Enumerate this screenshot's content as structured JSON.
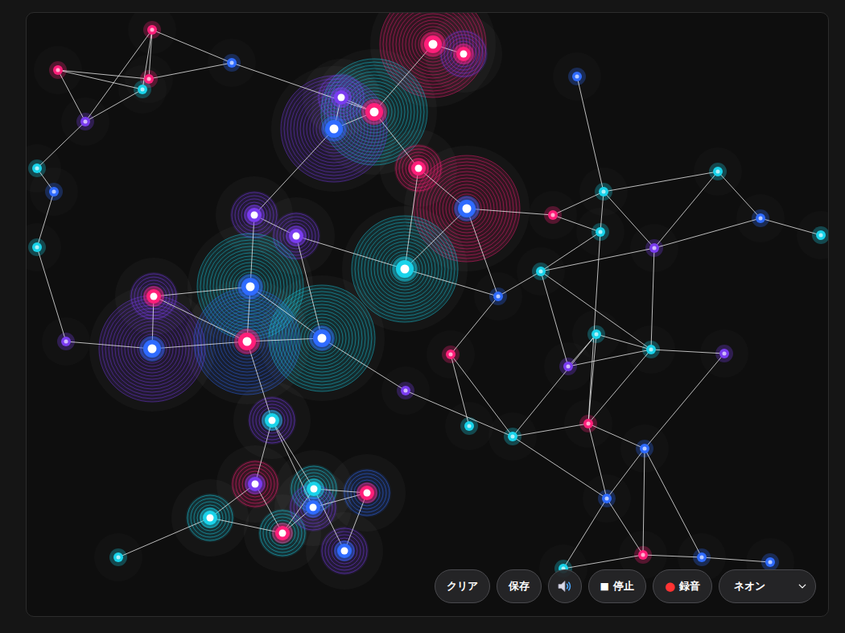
{
  "controls": {
    "clear": {
      "label": "クリア"
    },
    "save": {
      "label": "保存"
    },
    "stop": {
      "icon": "■",
      "label": "停止"
    },
    "record": {
      "icon": "●",
      "label": "録音"
    },
    "theme": {
      "value": "ネオン"
    }
  },
  "nodes": [
    {
      "color": "#ff1f7a",
      "ring_color": "#ff1f7a",
      "kind": "dot"
    },
    {
      "color": "#ff1f7a",
      "ring_color": "#ff1f7a",
      "kind": "dot"
    },
    {
      "color": "#ff1f7a",
      "ring_color": "#ff1f7a",
      "kind": "dot"
    },
    {
      "color": "#19d3ea",
      "ring_color": "#19d3ea",
      "kind": "dot"
    },
    {
      "color": "#2f6bff",
      "ring_color": "#2f6bff",
      "kind": "dot"
    },
    {
      "color": "#7a3cf0",
      "ring_color": "#7a3cf0",
      "kind": "dot"
    },
    {
      "color": "#19d3ea",
      "ring_color": "#19d3ea",
      "kind": "dot"
    },
    {
      "color": "#2f6bff",
      "ring_color": "#2f6bff",
      "kind": "dot"
    },
    {
      "color": "#19d3ea",
      "ring_color": "#19d3ea",
      "kind": "dot"
    },
    {
      "color": "#7a3cf0",
      "ring_color": "#7a3cf0",
      "kind": "dot"
    },
    {
      "color": "#ff1f7a",
      "ring_color": "#ff1f7a",
      "kind": "halo"
    },
    {
      "color": "#ff1f7a",
      "ring_color": "#7a3cf0",
      "kind": "ring"
    },
    {
      "color": "#7a3cf0",
      "ring_color": "#7a3cf0",
      "kind": "ring"
    },
    {
      "color": "#ff1f7a",
      "ring_color": "#19d3ea",
      "kind": "halo"
    },
    {
      "color": "#2f6bff",
      "ring_color": "#7a3cf0",
      "kind": "halo"
    },
    {
      "color": "#ff1f7a",
      "ring_color": "#ff1f7a",
      "kind": "ring"
    },
    {
      "color": "#2f6bff",
      "ring_color": "#ff1f7a",
      "kind": "halo"
    },
    {
      "color": "#7a3cf0",
      "ring_color": "#7a3cf0",
      "kind": "ring"
    },
    {
      "color": "#7a3cf0",
      "ring_color": "#7a3cf0",
      "kind": "ring"
    },
    {
      "color": "#19d3ea",
      "ring_color": "#19d3ea",
      "kind": "halo"
    },
    {
      "color": "#2f6bff",
      "ring_color": "#19d3ea",
      "kind": "halo"
    },
    {
      "color": "#ff1f7a",
      "ring_color": "#7a3cf0",
      "kind": "ring"
    },
    {
      "color": "#2f6bff",
      "ring_color": "#7a3cf0",
      "kind": "halo"
    },
    {
      "color": "#ff1f7a",
      "ring_color": "#2f6bff",
      "kind": "halo"
    },
    {
      "color": "#2f6bff",
      "ring_color": "#19d3ea",
      "kind": "halo"
    },
    {
      "color": "#2f6bff",
      "ring_color": "#2f6bff",
      "kind": "dot"
    },
    {
      "color": "#7a3cf0",
      "ring_color": "#7a3cf0",
      "kind": "dot"
    },
    {
      "color": "#ff1f7a",
      "ring_color": "#ff1f7a",
      "kind": "dot"
    },
    {
      "color": "#19d3ea",
      "ring_color": "#19d3ea",
      "kind": "dot"
    },
    {
      "color": "#19d3ea",
      "ring_color": "#19d3ea",
      "kind": "dot"
    },
    {
      "color": "#19d3ea",
      "ring_color": "#7a3cf0",
      "kind": "ring"
    },
    {
      "color": "#7a3cf0",
      "ring_color": "#ff1f7a",
      "kind": "ring"
    },
    {
      "color": "#19d3ea",
      "ring_color": "#19d3ea",
      "kind": "ring"
    },
    {
      "color": "#19d3ea",
      "ring_color": "#19d3ea",
      "kind": "dot"
    },
    {
      "color": "#ff1f7a",
      "ring_color": "#19d3ea",
      "kind": "ring"
    },
    {
      "color": "#19d3ea",
      "ring_color": "#19d3ea",
      "kind": "ring"
    },
    {
      "color": "#2f6bff",
      "ring_color": "#7a3cf0",
      "kind": "ring"
    },
    {
      "color": "#ff1f7a",
      "ring_color": "#2f6bff",
      "kind": "ring"
    },
    {
      "color": "#2f6bff",
      "ring_color": "#7a3cf0",
      "kind": "ring"
    },
    {
      "color": "#2f6bff",
      "ring_color": "#2f6bff",
      "kind": "dot"
    },
    {
      "color": "#19d3ea",
      "ring_color": "#19d3ea",
      "kind": "dot"
    },
    {
      "color": "#19d3ea",
      "ring_color": "#19d3ea",
      "kind": "dot"
    },
    {
      "color": "#2f6bff",
      "ring_color": "#2f6bff",
      "kind": "dot"
    },
    {
      "color": "#19d3ea",
      "ring_color": "#19d3ea",
      "kind": "dot"
    },
    {
      "color": "#ff1f7a",
      "ring_color": "#ff1f7a",
      "kind": "dot"
    },
    {
      "color": "#19d3ea",
      "ring_color": "#19d3ea",
      "kind": "dot"
    },
    {
      "color": "#7a3cf0",
      "ring_color": "#7a3cf0",
      "kind": "dot"
    },
    {
      "color": "#19d3ea",
      "ring_color": "#19d3ea",
      "kind": "dot"
    },
    {
      "color": "#19d3ea",
      "ring_color": "#19d3ea",
      "kind": "dot"
    },
    {
      "color": "#19d3ea",
      "ring_color": "#19d3ea",
      "kind": "dot"
    },
    {
      "color": "#7a3cf0",
      "ring_color": "#7a3cf0",
      "kind": "dot"
    },
    {
      "color": "#7a3cf0",
      "ring_color": "#7a3cf0",
      "kind": "dot"
    },
    {
      "color": "#ff1f7a",
      "ring_color": "#ff1f7a",
      "kind": "dot"
    },
    {
      "color": "#2f6bff",
      "ring_color": "#2f6bff",
      "kind": "dot"
    },
    {
      "color": "#2f6bff",
      "ring_color": "#2f6bff",
      "kind": "dot"
    },
    {
      "color": "#19d3ea",
      "ring_color": "#19d3ea",
      "kind": "dot"
    },
    {
      "color": "#ff1f7a",
      "ring_color": "#ff1f7a",
      "kind": "dot"
    },
    {
      "color": "#2f6bff",
      "ring_color": "#2f6bff",
      "kind": "dot"
    },
    {
      "color": "#2f6bff",
      "ring_color": "#2f6bff",
      "kind": "dot"
    }
  ],
  "edges": [
    [
      0,
      2
    ],
    [
      0,
      3
    ],
    [
      0,
      4
    ],
    [
      0,
      5
    ],
    [
      1,
      2
    ],
    [
      1,
      3
    ],
    [
      1,
      5
    ],
    [
      2,
      4
    ],
    [
      3,
      5
    ],
    [
      5,
      6
    ],
    [
      6,
      7
    ],
    [
      7,
      8
    ],
    [
      8,
      9
    ],
    [
      9,
      22
    ],
    [
      4,
      13
    ],
    [
      10,
      11
    ],
    [
      10,
      13
    ],
    [
      12,
      13
    ],
    [
      12,
      14
    ],
    [
      13,
      14
    ],
    [
      13,
      15
    ],
    [
      14,
      17
    ],
    [
      15,
      16
    ],
    [
      15,
      19
    ],
    [
      16,
      19
    ],
    [
      16,
      44
    ],
    [
      16,
      25
    ],
    [
      17,
      18
    ],
    [
      17,
      20
    ],
    [
      18,
      19
    ],
    [
      18,
      24
    ],
    [
      19,
      25
    ],
    [
      20,
      21
    ],
    [
      20,
      23
    ],
    [
      20,
      24
    ],
    [
      21,
      22
    ],
    [
      22,
      23
    ],
    [
      23,
      24
    ],
    [
      21,
      23
    ],
    [
      24,
      26
    ],
    [
      23,
      30
    ],
    [
      30,
      31
    ],
    [
      30,
      35
    ],
    [
      30,
      36
    ],
    [
      31,
      32
    ],
    [
      32,
      33
    ],
    [
      32,
      34
    ],
    [
      31,
      34
    ],
    [
      34,
      35
    ],
    [
      34,
      36
    ],
    [
      35,
      37
    ],
    [
      36,
      37
    ],
    [
      37,
      38
    ],
    [
      35,
      38
    ],
    [
      25,
      27
    ],
    [
      25,
      47
    ],
    [
      27,
      28
    ],
    [
      27,
      29
    ],
    [
      26,
      29
    ],
    [
      29,
      52
    ],
    [
      29,
      54
    ],
    [
      29,
      48
    ],
    [
      39,
      40
    ],
    [
      40,
      41
    ],
    [
      40,
      44
    ],
    [
      40,
      45
    ],
    [
      40,
      46
    ],
    [
      41,
      42
    ],
    [
      41,
      46
    ],
    [
      42,
      43
    ],
    [
      42,
      46
    ],
    [
      44,
      45
    ],
    [
      45,
      47
    ],
    [
      45,
      52
    ],
    [
      46,
      47
    ],
    [
      46,
      49
    ],
    [
      47,
      49
    ],
    [
      47,
      51
    ],
    [
      48,
      51
    ],
    [
      48,
      52
    ],
    [
      48,
      49
    ],
    [
      49,
      51
    ],
    [
      49,
      50
    ],
    [
      49,
      52
    ],
    [
      50,
      53
    ],
    [
      52,
      53
    ],
    [
      52,
      54
    ],
    [
      53,
      54
    ],
    [
      53,
      56
    ],
    [
      53,
      57
    ],
    [
      54,
      55
    ],
    [
      54,
      56
    ],
    [
      55,
      56
    ],
    [
      56,
      57
    ],
    [
      57,
      58
    ]
  ]
}
